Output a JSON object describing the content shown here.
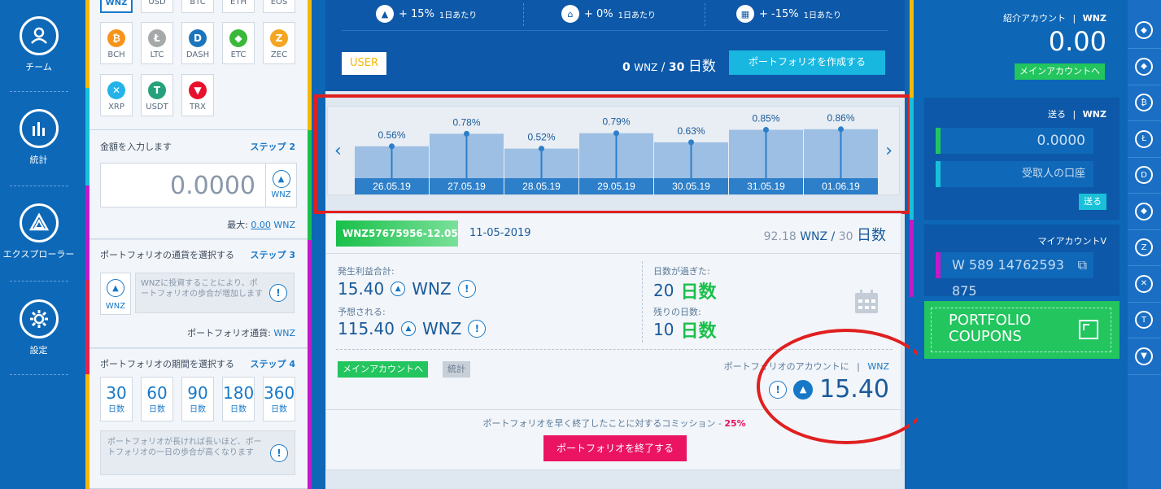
{
  "nav": {
    "items": [
      {
        "label": "チーム",
        "icon": "person-icon"
      },
      {
        "label": "統計",
        "icon": "stats-icon"
      },
      {
        "label": "エクスプローラー",
        "icon": "explorer-icon"
      },
      {
        "label": "設定",
        "icon": "gear-icon"
      }
    ]
  },
  "currencies": {
    "row0": [
      "WNZ",
      "USD",
      "BTC",
      "ETH",
      "EOS"
    ],
    "coins": [
      {
        "code": "BCH",
        "glyph": "₿",
        "color": "#f7931a"
      },
      {
        "code": "LTC",
        "glyph": "Ł",
        "color": "#a6a9aa"
      },
      {
        "code": "DASH",
        "glyph": "D",
        "color": "#1c75bc"
      },
      {
        "code": "ETC",
        "glyph": "◆",
        "color": "#3ab83a"
      },
      {
        "code": "ZEC",
        "glyph": "Z",
        "color": "#f4a522"
      },
      {
        "code": "XRP",
        "glyph": "✕",
        "color": "#23b3e8"
      },
      {
        "code": "USDT",
        "glyph": "T",
        "color": "#26a17b"
      },
      {
        "code": "TRX",
        "glyph": "▼",
        "color": "#e8112d"
      }
    ]
  },
  "step2": {
    "title": "金額を入力します",
    "step": "ステップ 2",
    "amount": "0.0000",
    "unit": "WNZ",
    "max_label": "最大:",
    "max_value": "0.00",
    "max_unit": "WNZ"
  },
  "step3": {
    "title": "ポートフォリオの通貨を選択する",
    "step": "ステップ 3",
    "unit": "WNZ",
    "info": "WNZに投資することにより、ポートフォリオの歩合が増加します",
    "currency_label": "ポートフォリオ通貨:",
    "currency_value": "WNZ"
  },
  "step4": {
    "title": "ポートフォリオの期間を選択する",
    "step": "ステップ 4",
    "periods": [
      {
        "n": "30",
        "u": "日数"
      },
      {
        "n": "60",
        "u": "日数"
      },
      {
        "n": "90",
        "u": "日数"
      },
      {
        "n": "180",
        "u": "日数"
      },
      {
        "n": "360",
        "u": "日数"
      }
    ],
    "info": "ポートフォリオが長ければ長いほど、ポートフォリオの一日の歩合が高くなります"
  },
  "rates": [
    {
      "value": "+ 15%",
      "label": "1日あたり"
    },
    {
      "value": "+ 0%",
      "label": "1日あたり"
    },
    {
      "value": "+ -15%",
      "label": "1日あたり"
    }
  ],
  "user": {
    "badge": "USER",
    "wnz": "0",
    "wnz_unit": "WNZ",
    "slash": "/",
    "days": "30",
    "days_unit": "日数",
    "create_button": "ポートフォリオを作成する"
  },
  "chart_data": {
    "type": "bar",
    "categories": [
      "26.05.19",
      "27.05.19",
      "28.05.19",
      "29.05.19",
      "30.05.19",
      "31.05.19",
      "01.06.19"
    ],
    "values": [
      0.56,
      0.78,
      0.52,
      0.79,
      0.63,
      0.85,
      0.86
    ],
    "labels": [
      "0.56%",
      "0.78%",
      "0.52%",
      "0.79%",
      "0.63%",
      "0.85%",
      "0.86%"
    ],
    "title": "",
    "xlabel": "",
    "ylabel": ""
  },
  "portfolio": {
    "id": "WNZ57675956-12.05",
    "date": "11-05-2019",
    "amount": "92.18",
    "amount_unit": "WNZ",
    "slash": "/",
    "days": "30",
    "days_unit": "日数",
    "profit_label": "発生利益合計:",
    "profit_value": "15.40",
    "profit_unit": "WNZ",
    "expected_label": "予想される:",
    "expected_value": "115.40",
    "expected_unit": "WNZ",
    "passed_label": "日数が過ぎた:",
    "passed_value": "20",
    "passed_unit": "日数",
    "remaining_label": "残りの日数:",
    "remaining_value": "10",
    "remaining_unit": "日数",
    "main_account_btn": "メインアカウントへ",
    "stats_btn": "統計",
    "account_label": "ポートフォリオのアカウントに",
    "account_sep": "|",
    "account_unit": "WNZ",
    "account_value": "15.40",
    "commission_text": "ポートフォリオを早く終了したことに対するコミッション -",
    "commission_value": "25%",
    "end_button": "ポートフォリオを終了する"
  },
  "right": {
    "referral_label": "紹介アカウント",
    "referral_sep": "|",
    "referral_unit": "WNZ",
    "referral_value": "0.00",
    "main_btn": "メインアカウントへ",
    "send_label": "送る",
    "send_sep": "|",
    "send_unit": "WNZ",
    "send_amount": "0.0000",
    "recipient": "受取人の口座",
    "send_btn": "送る",
    "my_account_label": "マイアカウントV",
    "my_account_value": "W 589 14762593 875",
    "coupons_line1": "PORTFOLIO",
    "coupons_line2": "COUPONS"
  },
  "coinbar": [
    "eth-icon",
    "etc-icon",
    "btc-icon",
    "ltc-icon",
    "dash-icon",
    "eth-icon",
    "zec-icon",
    "xrp-icon",
    "usdt-icon",
    "trx-icon"
  ]
}
